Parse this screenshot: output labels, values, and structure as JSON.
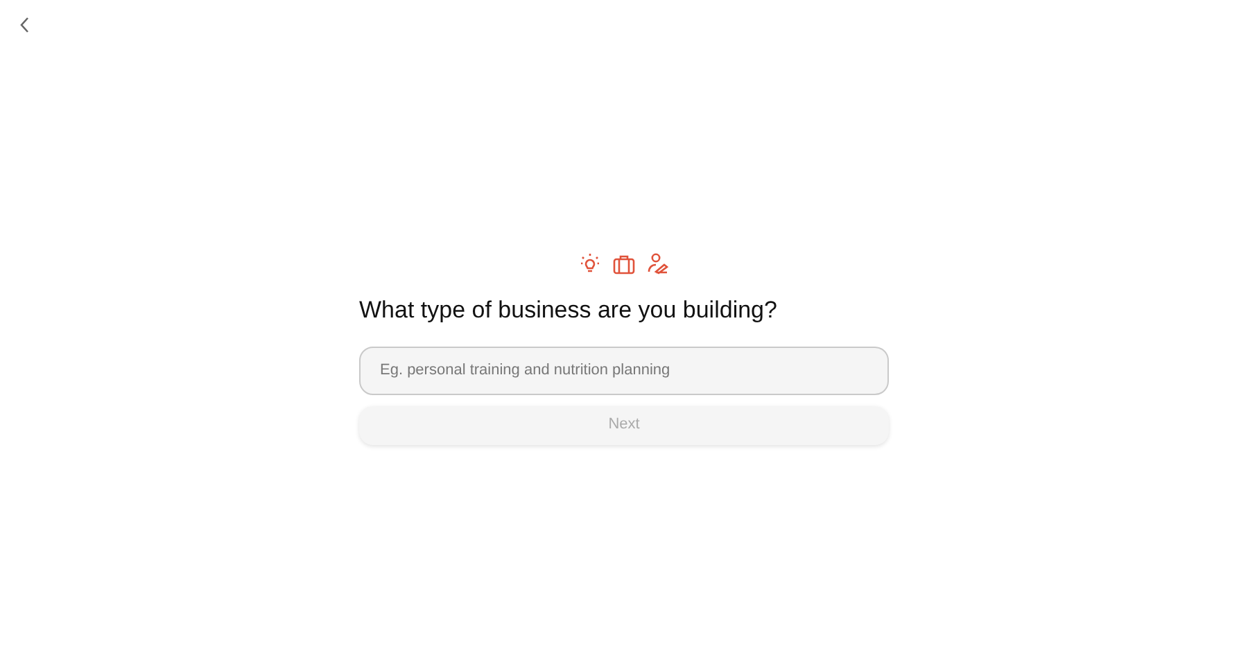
{
  "question": "What type of business are you building?",
  "field": {
    "placeholder": "Eg. personal training and nutrition planning"
  },
  "next_button": {
    "label": "Next",
    "disabled": true
  }
}
